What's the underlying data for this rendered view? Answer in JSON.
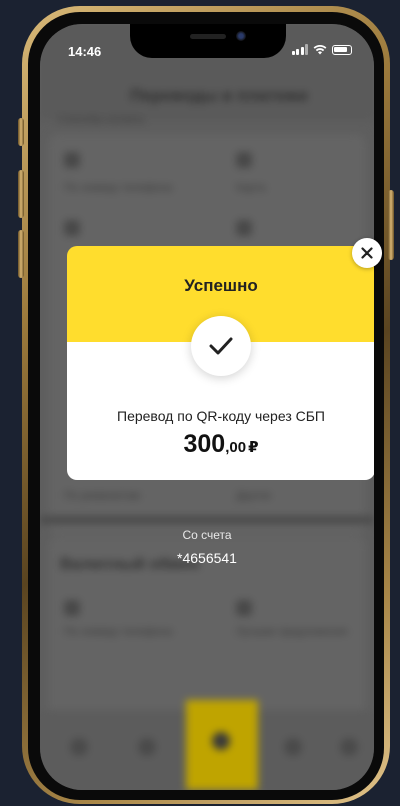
{
  "status_bar": {
    "time": "14:46"
  },
  "background_app": {
    "title": "Переводы и платежи",
    "sections": [
      {
        "label": "Способы оплаты",
        "items": [
          "По номеру телефона",
          "Карта"
        ]
      },
      {
        "label": "",
        "items": [
          "По реквизитам",
          "Другое"
        ]
      }
    ],
    "section2_title": "Валютный обмен",
    "section2_items": [
      "По номеру телефона",
      "Лучшие предложения"
    ]
  },
  "modal": {
    "title": "Успешно",
    "description": "Перевод по QR-коду через СБП",
    "amount_integer": "300",
    "amount_fraction": ",00",
    "currency": "₽",
    "check_icon": "check-icon",
    "close_icon": "close-icon"
  },
  "source_account": {
    "label": "Со счета",
    "value": "*4656541"
  },
  "colors": {
    "accent_yellow": "#ffdd2d",
    "modal_bg": "#ffffff",
    "page_bg": "#1b2231"
  }
}
